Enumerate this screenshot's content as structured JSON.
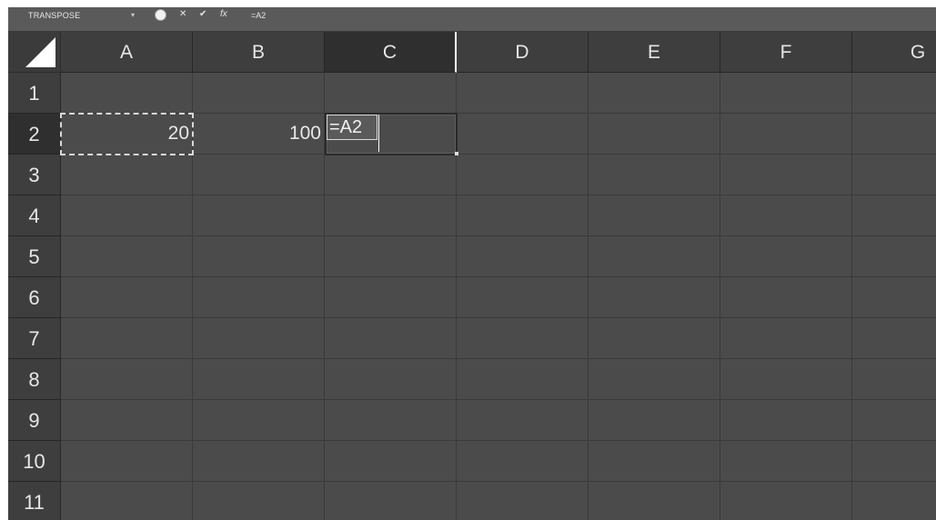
{
  "formula_bar": {
    "name_box": "TRANSPOSE",
    "dropdown_glyph": "▾",
    "cancel_glyph": "✕",
    "enter_glyph": "✔",
    "fx_glyph": "fx",
    "formula": "=A2"
  },
  "columns": [
    "A",
    "B",
    "C",
    "D",
    "E",
    "F",
    "G"
  ],
  "selected_column": "C",
  "rows": [
    "1",
    "2",
    "3",
    "4",
    "5",
    "6",
    "7",
    "8",
    "9",
    "10",
    "11"
  ],
  "selected_row": "2",
  "cells": {
    "A2": "20",
    "B2": "100",
    "C2": "=A2"
  },
  "copy_source": "A2",
  "editing_cell": "C2",
  "icons": [
    "dropdown-icon",
    "record-icon",
    "cancel-icon",
    "enter-icon",
    "fx-icon",
    "select-all-icon"
  ],
  "colors": {
    "grid_bg": "#4b4b4b",
    "header_bg": "#3e3e3e",
    "text": "#e8e8e8"
  }
}
